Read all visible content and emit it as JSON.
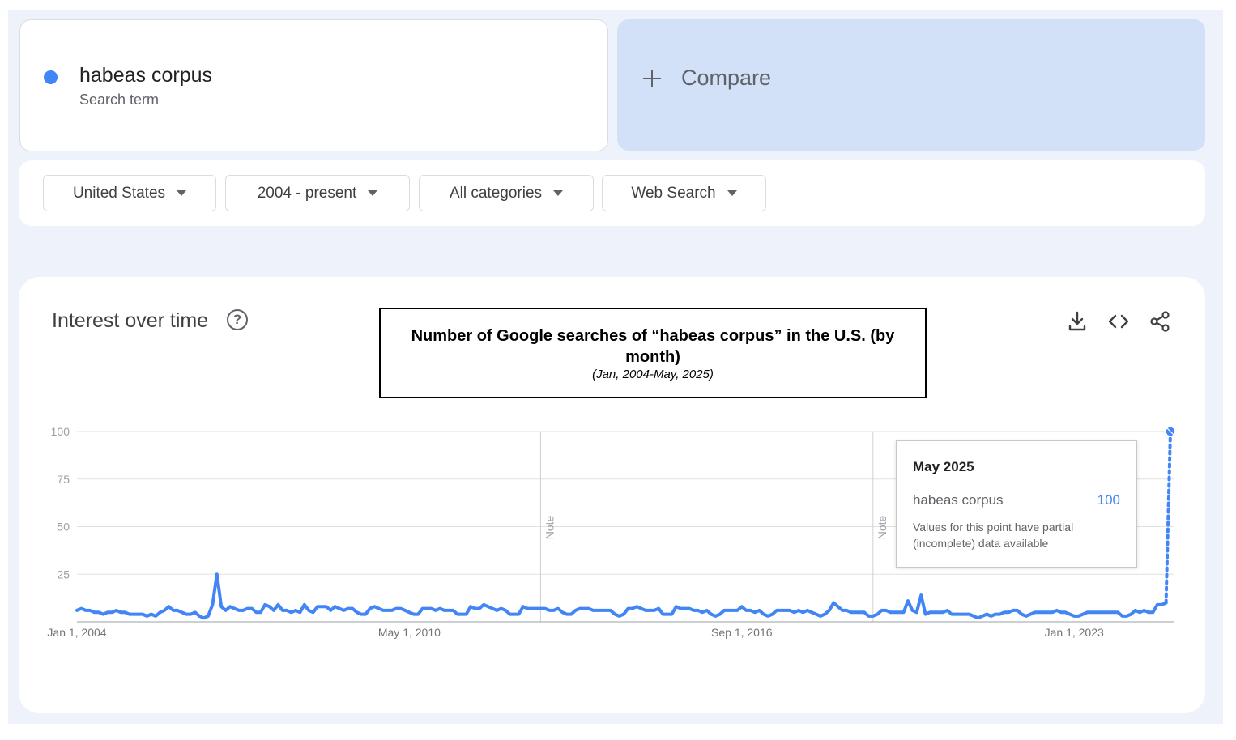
{
  "search_term": {
    "name": "habeas corpus",
    "type_label": "Search term",
    "color": "#4285f4"
  },
  "compare": {
    "label": "Compare"
  },
  "filters": {
    "region": "United States",
    "time_range": "2004 - present",
    "category": "All categories",
    "search_type": "Web Search"
  },
  "section": {
    "title": "Interest over time",
    "help_glyph": "?"
  },
  "toolbar_icons": [
    "download-icon",
    "embed-code-icon",
    "share-icon"
  ],
  "annotation_box": {
    "title": "Number of Google searches of “habeas corpus” in the U.S. (by month)",
    "subtitle": "(Jan, 2004-May, 2025)"
  },
  "notes": [
    "Note",
    "Note"
  ],
  "tooltip": {
    "date": "May 2025",
    "term": "habeas corpus",
    "value": "100",
    "note": "Values for this point have partial (incomplete) data available"
  },
  "chart_data": {
    "type": "line",
    "series": [
      {
        "name": "habeas corpus",
        "color": "#4285f4",
        "values": [
          6,
          7,
          6,
          6,
          5,
          5,
          4,
          5,
          5,
          6,
          5,
          5,
          4,
          4,
          4,
          4,
          3,
          4,
          3,
          5,
          6,
          8,
          6,
          6,
          5,
          4,
          4,
          5,
          3,
          2,
          3,
          9,
          25,
          8,
          6,
          8,
          7,
          6,
          6,
          7,
          7,
          5,
          5,
          9,
          8,
          6,
          9,
          6,
          6,
          5,
          6,
          5,
          9,
          6,
          5,
          8,
          8,
          8,
          6,
          8,
          7,
          6,
          7,
          7,
          5,
          4,
          4,
          7,
          8,
          7,
          6,
          6,
          6,
          7,
          7,
          6,
          5,
          4,
          4,
          7,
          7,
          7,
          6,
          7,
          6,
          6,
          6,
          4,
          4,
          4,
          8,
          7,
          7,
          9,
          8,
          7,
          6,
          7,
          6,
          4,
          4,
          4,
          8,
          7,
          7,
          7,
          7,
          7,
          6,
          6,
          7,
          5,
          4,
          4,
          6,
          7,
          7,
          7,
          6,
          6,
          6,
          6,
          6,
          4,
          3,
          4,
          7,
          7,
          8,
          7,
          6,
          6,
          6,
          7,
          4,
          4,
          4,
          8,
          7,
          7,
          7,
          6,
          6,
          5,
          6,
          4,
          3,
          4,
          6,
          6,
          6,
          6,
          8,
          6,
          6,
          5,
          6,
          4,
          3,
          4,
          6,
          6,
          6,
          6,
          5,
          6,
          5,
          6,
          5,
          4,
          3,
          4,
          6,
          10,
          8,
          6,
          6,
          5,
          5,
          5,
          5,
          3,
          3,
          4,
          6,
          6,
          5,
          5,
          5,
          5,
          11,
          6,
          5,
          14,
          4,
          5,
          5,
          5,
          5,
          6,
          4,
          4,
          4,
          4,
          4,
          3,
          2,
          3,
          4,
          3,
          4,
          4,
          5,
          5,
          6,
          6,
          4,
          3,
          4,
          5,
          5,
          5,
          5,
          5,
          6,
          5,
          5,
          4,
          3,
          3,
          4,
          5,
          5,
          5,
          5,
          5,
          5,
          5,
          5,
          3,
          3,
          4,
          6,
          5,
          6,
          5,
          5,
          9,
          9,
          10,
          100
        ]
      }
    ],
    "x_tick_labels": [
      "Jan 1, 2004",
      "May 1, 2010",
      "Sep 1, 2016",
      "Jan 1, 2023"
    ],
    "x_tick_index": [
      0,
      76,
      152,
      228
    ],
    "note_index": [
      106,
      182,
      274
    ],
    "ylim": [
      0,
      100
    ],
    "yticks": [
      25,
      50,
      75,
      100
    ],
    "grid": true,
    "partial_last_point": true
  }
}
